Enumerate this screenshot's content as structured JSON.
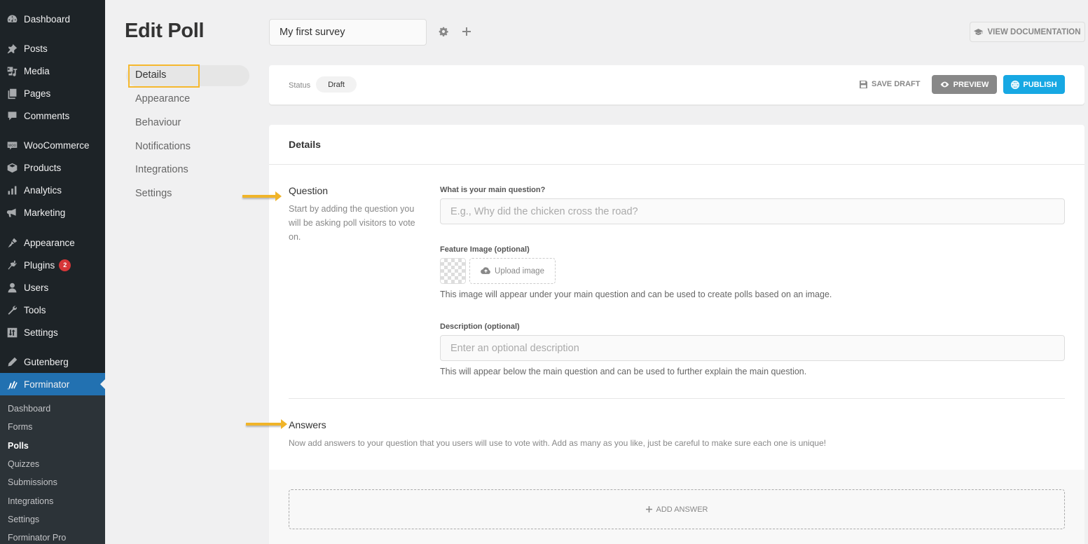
{
  "sidebar": {
    "items": [
      {
        "label": "Dashboard",
        "icon": "dashboard-icon"
      },
      {
        "label": "Posts",
        "icon": "pin-icon"
      },
      {
        "label": "Media",
        "icon": "media-icon"
      },
      {
        "label": "Pages",
        "icon": "pages-icon"
      },
      {
        "label": "Comments",
        "icon": "comment-icon"
      },
      {
        "label": "WooCommerce",
        "icon": "woo-icon"
      },
      {
        "label": "Products",
        "icon": "box-icon"
      },
      {
        "label": "Analytics",
        "icon": "bar-chart-icon"
      },
      {
        "label": "Marketing",
        "icon": "megaphone-icon"
      },
      {
        "label": "Appearance",
        "icon": "paintbrush-icon"
      },
      {
        "label": "Plugins",
        "icon": "plug-icon",
        "badge": "2"
      },
      {
        "label": "Users",
        "icon": "user-icon"
      },
      {
        "label": "Tools",
        "icon": "wrench-icon"
      },
      {
        "label": "Settings",
        "icon": "sliders-icon"
      },
      {
        "label": "Gutenberg",
        "icon": "pencil-icon"
      },
      {
        "label": "Forminator",
        "icon": "forminator-icon",
        "current": true
      }
    ],
    "submenu": [
      {
        "label": "Dashboard"
      },
      {
        "label": "Forms"
      },
      {
        "label": "Polls",
        "active": true
      },
      {
        "label": "Quizzes"
      },
      {
        "label": "Submissions"
      },
      {
        "label": "Integrations"
      },
      {
        "label": "Settings"
      },
      {
        "label": "Forminator Pro"
      }
    ]
  },
  "header": {
    "title": "Edit Poll",
    "poll_name": "My first survey",
    "settings_icon": "gear-icon",
    "add_icon": "plus-icon",
    "doc_button": "VIEW DOCUMENTATION"
  },
  "tabs": [
    {
      "label": "Details",
      "active": true
    },
    {
      "label": "Appearance"
    },
    {
      "label": "Behaviour"
    },
    {
      "label": "Notifications"
    },
    {
      "label": "Integrations"
    },
    {
      "label": "Settings"
    }
  ],
  "status_bar": {
    "status_label": "Status",
    "status_value": "Draft",
    "save_draft": "SAVE DRAFT",
    "preview": "PREVIEW",
    "publish": "PUBLISH"
  },
  "details": {
    "title": "Details",
    "question": {
      "title": "Question",
      "description": "Start by adding the question you will be asking poll visitors to vote on.",
      "main_label": "What is your main question?",
      "main_placeholder": "E.g., Why did the chicken cross the road?",
      "main_value": "",
      "image_label": "Feature Image (optional)",
      "upload_label": "Upload image",
      "image_help": "This image will appear under your main question and can be used to create polls based on an image.",
      "desc_label": "Description (optional)",
      "desc_placeholder": "Enter an optional description",
      "desc_value": "",
      "desc_help": "This will appear below the main question and can be used to further explain the main question."
    },
    "answers": {
      "title": "Answers",
      "description": "Now add answers to your question that you users will use to vote with. Add as many as you like, just be careful to make sure each one is unique!",
      "add_label": "ADD ANSWER"
    }
  },
  "colors": {
    "admin_bg": "#1d2327",
    "admin_current": "#2271b1",
    "publish": "#17a8e3",
    "preview": "#888888",
    "highlight": "#f5b82e"
  }
}
